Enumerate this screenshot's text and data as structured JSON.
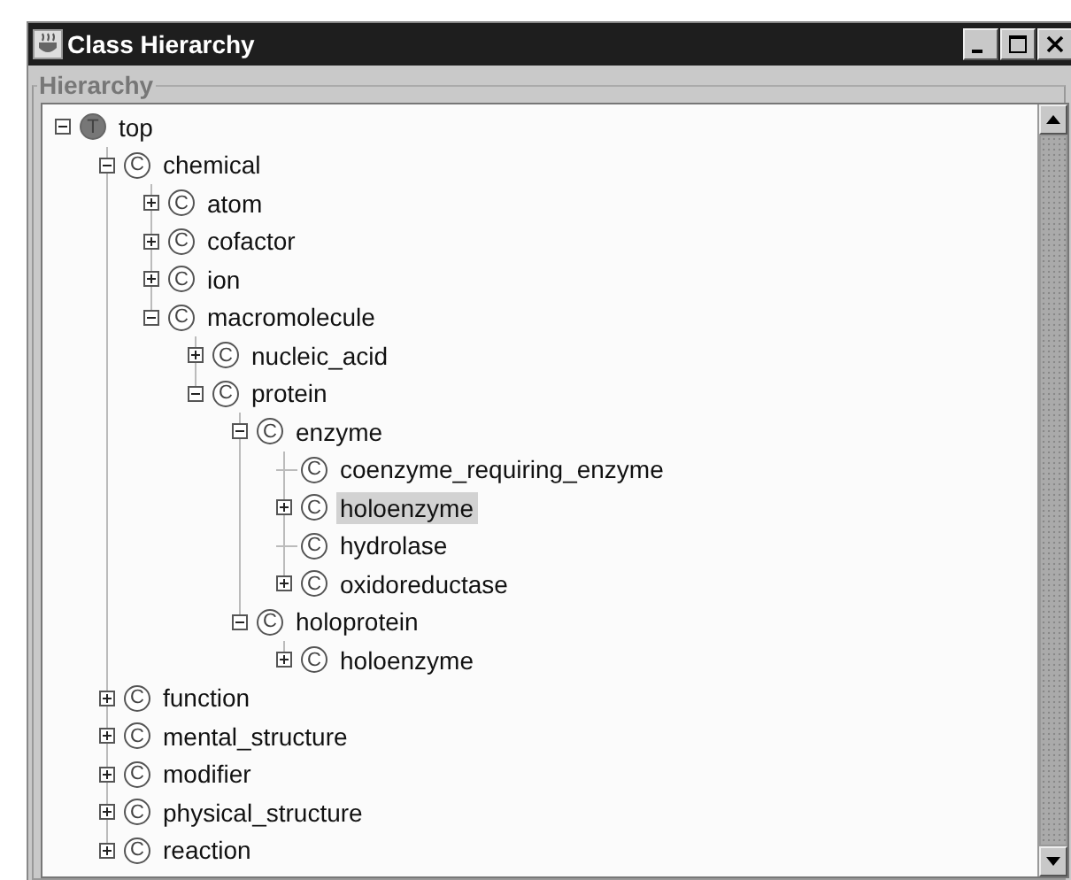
{
  "window": {
    "title": "Class Hierarchy"
  },
  "group": {
    "label": "Hierarchy"
  },
  "tree": [
    {
      "label": "top",
      "kind": "top",
      "badge": "T",
      "expanded": true,
      "selected": false,
      "children": [
        {
          "label": "chemical",
          "kind": "class",
          "badge": "C",
          "expanded": true,
          "selected": false,
          "children": [
            {
              "label": "atom",
              "kind": "class",
              "badge": "C",
              "expanded": false,
              "selected": false
            },
            {
              "label": "cofactor",
              "kind": "class",
              "badge": "C",
              "expanded": false,
              "selected": false
            },
            {
              "label": "ion",
              "kind": "class",
              "badge": "C",
              "expanded": false,
              "selected": false
            },
            {
              "label": "macromolecule",
              "kind": "class",
              "badge": "C",
              "expanded": true,
              "selected": false,
              "children": [
                {
                  "label": "nucleic_acid",
                  "kind": "class",
                  "badge": "C",
                  "expanded": false,
                  "selected": false
                },
                {
                  "label": "protein",
                  "kind": "class",
                  "badge": "C",
                  "expanded": true,
                  "selected": false,
                  "children": [
                    {
                      "label": "enzyme",
                      "kind": "class",
                      "badge": "C",
                      "expanded": true,
                      "selected": false,
                      "children": [
                        {
                          "label": "coenzyme_requiring_enzyme",
                          "kind": "class",
                          "badge": "C",
                          "selected": false
                        },
                        {
                          "label": "holoenzyme",
                          "kind": "class",
                          "badge": "C",
                          "expanded": false,
                          "selected": true
                        },
                        {
                          "label": "hydrolase",
                          "kind": "class",
                          "badge": "C",
                          "selected": false
                        },
                        {
                          "label": "oxidoreductase",
                          "kind": "class",
                          "badge": "C",
                          "expanded": false,
                          "selected": false
                        }
                      ]
                    },
                    {
                      "label": "holoprotein",
                      "kind": "class",
                      "badge": "C",
                      "expanded": true,
                      "selected": false,
                      "children": [
                        {
                          "label": "holoenzyme",
                          "kind": "class",
                          "badge": "C",
                          "expanded": false,
                          "selected": false
                        }
                      ]
                    }
                  ]
                }
              ]
            }
          ]
        },
        {
          "label": "function",
          "kind": "class",
          "badge": "C",
          "expanded": false,
          "selected": false
        },
        {
          "label": "mental_structure",
          "kind": "class",
          "badge": "C",
          "expanded": false,
          "selected": false
        },
        {
          "label": "modifier",
          "kind": "class",
          "badge": "C",
          "expanded": false,
          "selected": false
        },
        {
          "label": "physical_structure",
          "kind": "class",
          "badge": "C",
          "expanded": false,
          "selected": false
        },
        {
          "label": "reaction",
          "kind": "class",
          "badge": "C",
          "expanded": false,
          "selected": false
        }
      ]
    }
  ]
}
